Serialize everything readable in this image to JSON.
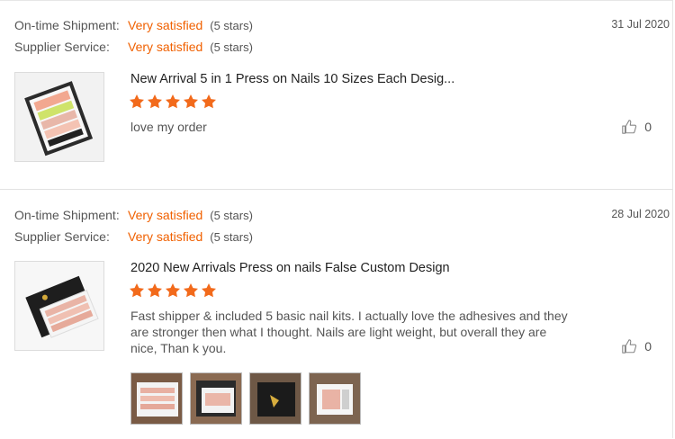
{
  "reviews": [
    {
      "ratings": [
        {
          "label": "On-time Shipment:",
          "value": "Very satisfied",
          "stars": "(5 stars)"
        },
        {
          "label": "Supplier Service:",
          "value": "Very satisfied",
          "stars": "(5 stars)"
        }
      ],
      "date": "31 Jul 2020",
      "product_title": "New Arrival 5 in 1 Press on Nails 10 Sizes Each Desig...",
      "star_rating": 5,
      "comment": "love my order",
      "likes": "0"
    },
    {
      "ratings": [
        {
          "label": "On-time Shipment:",
          "value": "Very satisfied",
          "stars": "(5 stars)"
        },
        {
          "label": "Supplier Service:",
          "value": "Very satisfied",
          "stars": "(5 stars)"
        }
      ],
      "date": "28 Jul 2020",
      "product_title": "2020 New Arrivals Press on nails False Custom Design",
      "star_rating": 5,
      "comment": "Fast shipper & included 5 basic nail kits. I actually love the adhesives and they are stronger then what I thought. Nails are light weight, but overall they are nice, Than k you.",
      "likes": "0",
      "photo_count": 4
    }
  ],
  "colors": {
    "accent": "#f06000",
    "star": "#f26a1b"
  },
  "icons": {
    "like": "thumbs-up-icon",
    "star": "star-icon"
  }
}
